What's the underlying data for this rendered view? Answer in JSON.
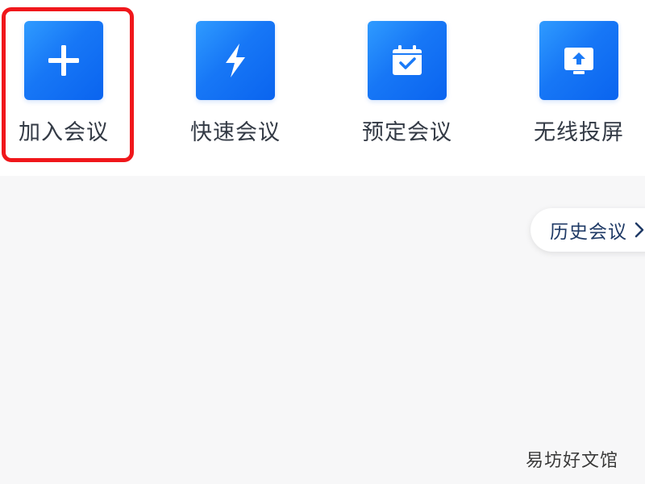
{
  "actions": [
    {
      "label": "加入会议",
      "icon": "plus-icon"
    },
    {
      "label": "快速会议",
      "icon": "lightning-icon"
    },
    {
      "label": "预定会议",
      "icon": "calendar-check-icon"
    },
    {
      "label": "无线投屏",
      "icon": "screen-share-icon"
    }
  ],
  "history": {
    "label": "历史会议",
    "icon": "chevron-right-icon"
  },
  "watermark": "易坊好文馆",
  "colors": {
    "tile_gradient_start": "#2f9bff",
    "tile_gradient_end": "#0a64ef",
    "highlight": "#f0171b",
    "page_background": "#f7f7f8",
    "panel_background": "#ffffff"
  }
}
